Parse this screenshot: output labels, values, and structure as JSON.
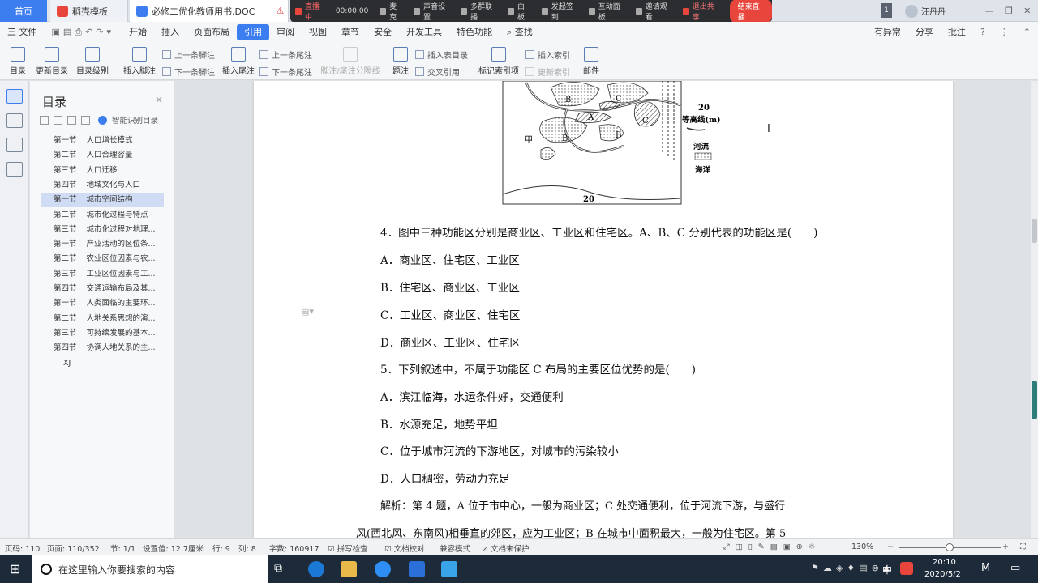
{
  "tabs": {
    "home": "首页",
    "template": "稻壳模板",
    "doc": "必修二优化教师用书.DOC",
    "warn": "⚠",
    "partial": "稻..."
  },
  "live": {
    "status": "直播中",
    "time": "00:00:00",
    "mic": "麦克",
    "sound": "声音设置",
    "members": "多群联播",
    "whiteboard": "白板",
    "signin": "发起签到",
    "interact": "互动面板",
    "invite": "邀请观看",
    "exit": "退出共享",
    "end": "结束直播"
  },
  "user": {
    "badge": "1",
    "name": "汪丹丹"
  },
  "menu": {
    "file": "三 文件",
    "items": [
      "开始",
      "插入",
      "页面布局",
      "引用",
      "审阅",
      "视图",
      "章节",
      "安全",
      "开发工具",
      "特色功能"
    ],
    "active": "引用",
    "search": "查找",
    "right": [
      "有异常",
      "分享",
      "批注"
    ]
  },
  "ribbon": {
    "toc": "目录",
    "update_toc": "更新目录",
    "toc_level": "目录级别",
    "insert_footnote": "插入脚注",
    "prev_footnote": "上一条脚注",
    "next_footnote": "下一条脚注",
    "insert_endnote": "插入尾注",
    "prev_endnote": "上一条尾注",
    "next_endnote": "下一条尾注",
    "footnote_sep": "脚注/尾注分隔线",
    "caption": "题注",
    "insert_table_toc": "插入表目录",
    "cross_ref": "交叉引用",
    "mark_index": "标记索引项",
    "insert_index": "插入索引",
    "update_index": "更新索引",
    "mail": "邮件"
  },
  "toc": {
    "title": "目录",
    "smart": "智能识别目录",
    "items": [
      {
        "num": "第一节",
        "text": "人口增长模式"
      },
      {
        "num": "第二节",
        "text": "人口合理容量"
      },
      {
        "num": "第三节",
        "text": "人口迁移"
      },
      {
        "num": "第四节",
        "text": "地域文化与人口"
      },
      {
        "num": "第一节",
        "text": "城市空间结构"
      },
      {
        "num": "第二节",
        "text": "城市化过程与特点"
      },
      {
        "num": "第三节",
        "text": "城市化过程对地理..."
      },
      {
        "num": "第一节",
        "text": "产业活动的区位条..."
      },
      {
        "num": "第二节",
        "text": "农业区位因素与农..."
      },
      {
        "num": "第三节",
        "text": "工业区位因素与工..."
      },
      {
        "num": "第四节",
        "text": "交通运输布局及其..."
      },
      {
        "num": "第一节",
        "text": "人类面临的主要环..."
      },
      {
        "num": "第二节",
        "text": "人地关系思想的演..."
      },
      {
        "num": "第三节",
        "text": "可持续发展的基本..."
      },
      {
        "num": "第四节",
        "text": "协调人地关系的主..."
      },
      {
        "num": "",
        "text": "XJ"
      }
    ],
    "selected_index": 4
  },
  "map": {
    "labels": [
      "B",
      "C",
      "A",
      "C",
      "B",
      "B",
      "甲"
    ],
    "contour": "20",
    "contour_bottom": "20",
    "legend": [
      "等高线(m)",
      "河流",
      "海洋"
    ]
  },
  "content": {
    "q4": "4．图中三种功能区分别是商业区、工业区和住宅区。A、B、C 分别代表的功能区是(　　)",
    "q4a": "A．商业区、住宅区、工业区",
    "q4b": "B．住宅区、商业区、工业区",
    "q4c": "C．工业区、商业区、住宅区",
    "q4d": "D．商业区、工业区、住宅区",
    "q5": "5．下列叙述中，不属于功能区 C 布局的主要区位优势的是(　　)",
    "q5a": "A．滨江临海，水运条件好，交通便利",
    "q5b": "B．水源充足，地势平坦",
    "q5c": "C．位于城市河流的下游地区，对城市的污染较小",
    "q5d": "D．人口稠密，劳动力充足",
    "ans1": "解析：第 4 题，A 位于市中心，一般为商业区；C 处交通便利，位于河流下游，与盛行",
    "ans2": "风(西北风、东南风)相垂直的郊区，应为工业区；B 在城市中面积最大，一般为住宅区。第 5"
  },
  "status": {
    "page_num": "页码: 110",
    "pages": "页面: 110/352",
    "section": "节: 1/1",
    "setting": "设置值: 12.7厘米",
    "row": "行: 9",
    "col": "列: 8",
    "words": "字数: 160917",
    "spell": "拼写检查",
    "proof": "文档校对",
    "compat": "兼容模式",
    "protect": "文档未保护",
    "zoom": "130%"
  },
  "taskbar": {
    "search": "在这里输入你要搜索的内容",
    "time": "20:10",
    "date": "2020/5/2",
    "ime": "中"
  }
}
